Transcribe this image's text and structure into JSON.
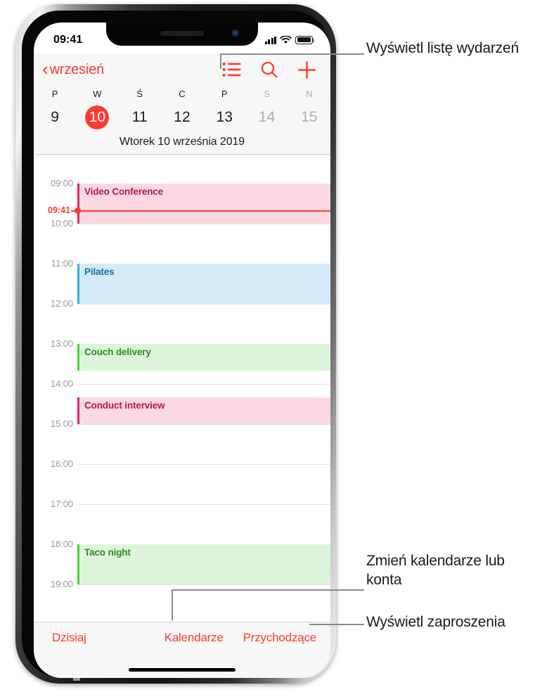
{
  "status_bar": {
    "time": "09:41",
    "icons": [
      "cellular-signal-icon",
      "wifi-icon",
      "battery-icon"
    ]
  },
  "nav_bar": {
    "back_label": "wrzesień",
    "back_icon": "chevron-left-icon",
    "actions": [
      {
        "name": "list-view-icon",
        "label": "Lista"
      },
      {
        "name": "search-icon",
        "label": "Szukaj"
      },
      {
        "name": "plus-icon",
        "label": "Dodaj"
      }
    ]
  },
  "week_strip": {
    "weekdays": [
      {
        "label": "P",
        "dim": false
      },
      {
        "label": "W",
        "dim": false
      },
      {
        "label": "Ś",
        "dim": false
      },
      {
        "label": "C",
        "dim": false
      },
      {
        "label": "P",
        "dim": false
      },
      {
        "label": "S",
        "dim": true
      },
      {
        "label": "N",
        "dim": true
      }
    ],
    "days": [
      {
        "num": "9",
        "selected": false,
        "dim": false
      },
      {
        "num": "10",
        "selected": true,
        "dim": false
      },
      {
        "num": "11",
        "selected": false,
        "dim": false
      },
      {
        "num": "12",
        "selected": false,
        "dim": false
      },
      {
        "num": "13",
        "selected": false,
        "dim": false
      },
      {
        "num": "14",
        "selected": false,
        "dim": true
      },
      {
        "num": "15",
        "selected": false,
        "dim": true
      }
    ],
    "full_date": "Wtorek  10 września 2019"
  },
  "timeline": {
    "hours": [
      "09:00",
      "10:00",
      "11:00",
      "12:00",
      "13:00",
      "14:00",
      "15:00",
      "16:00",
      "17:00",
      "18:00",
      "19:00"
    ],
    "now": {
      "label": "09:41"
    },
    "events": [
      {
        "title": "Video Conference",
        "start": "09:00",
        "end": "10:00",
        "fill": "#fcd9e2",
        "accent": "#e8265f",
        "text": "#b41a4a"
      },
      {
        "title": "Pilates",
        "start": "11:00",
        "end": "12:00",
        "fill": "#d4ebf8",
        "accent": "#36a9e1",
        "text": "#1b6f9e"
      },
      {
        "title": "Couch delivery",
        "start": "13:00",
        "end": "13:40",
        "fill": "#dcf5da",
        "accent": "#45d62f",
        "text": "#2f8d22"
      },
      {
        "title": "Conduct interview",
        "start": "14:20",
        "end": "15:00",
        "fill": "#fcd9e2",
        "accent": "#e8265f",
        "text": "#b41a4a"
      },
      {
        "title": "Taco night",
        "start": "18:00",
        "end": "19:00",
        "fill": "#dcf5da",
        "accent": "#45d62f",
        "text": "#2f8d22"
      }
    ]
  },
  "toolbar": {
    "today_label": "Dzisiaj",
    "calendars_label": "Kalendarze",
    "inbox_label": "Przychodzące"
  },
  "callouts": [
    {
      "text": "Wyświetl listę wydarzeń"
    },
    {
      "text": "Zmień kalendarze lub konta"
    },
    {
      "text": "Wyświetl zaproszenia"
    }
  ],
  "colors": {
    "accent_red": "#ff3b30",
    "chrome_bg": "#f7f7f7",
    "leader_gray": "#8a8a8a"
  }
}
